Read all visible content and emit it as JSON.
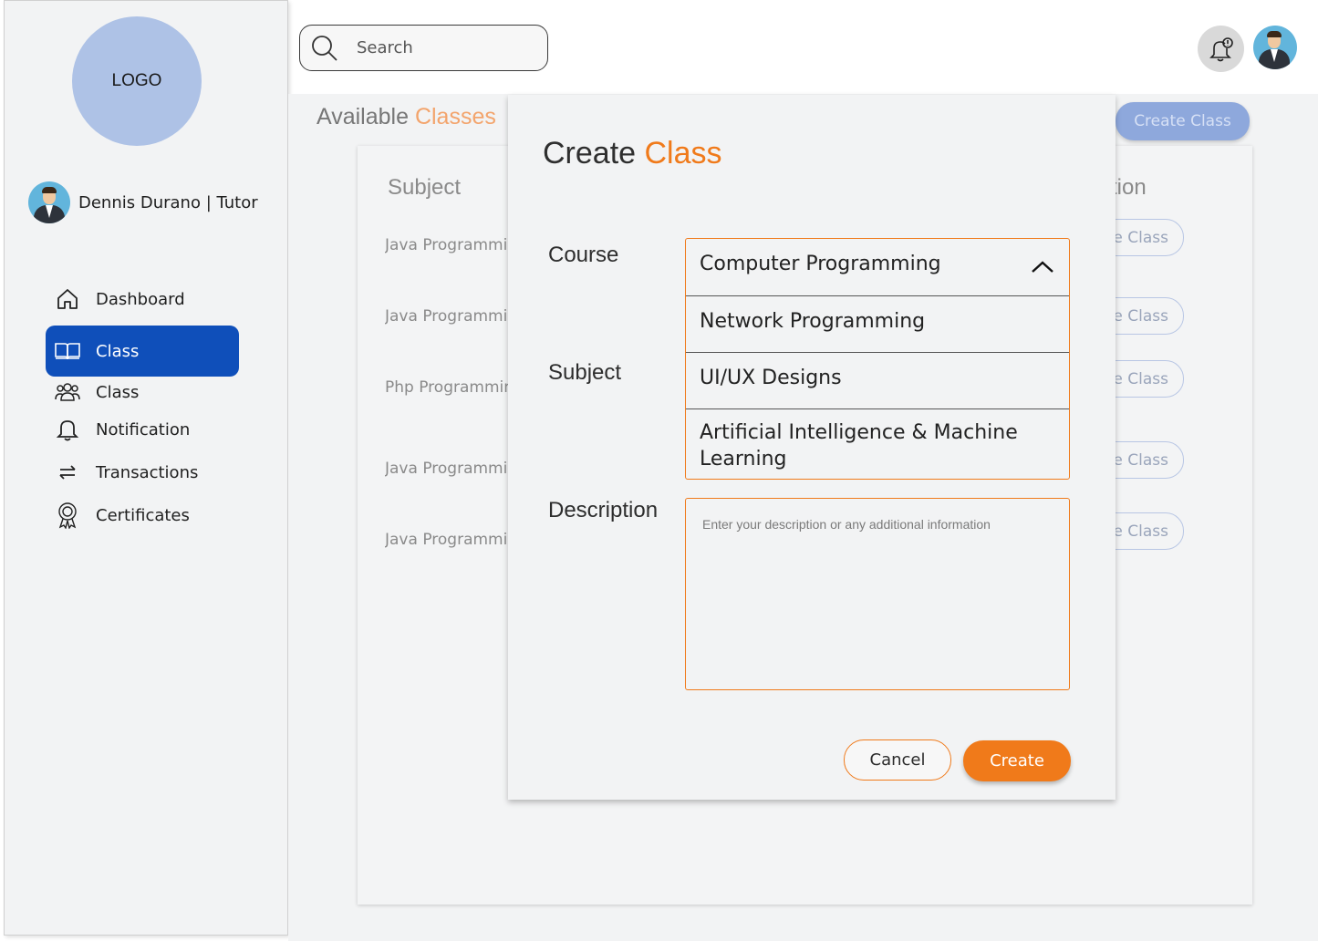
{
  "sidebar": {
    "logo_text": "LOGO",
    "user_name": "Dennis Durano | Tutor",
    "nav": [
      {
        "label": "Dashboard",
        "icon": "home-icon"
      },
      {
        "label": "Class",
        "icon": "book-icon",
        "active": true
      },
      {
        "label": "Class",
        "icon": "users-icon"
      },
      {
        "label": "Notification",
        "icon": "bell-icon"
      },
      {
        "label": "Transactions",
        "icon": "swap-arrows-icon"
      },
      {
        "label": "Certificates",
        "icon": "certificate-icon"
      }
    ]
  },
  "topbar": {
    "search_placeholder": "Search"
  },
  "page": {
    "title_plain": "Available ",
    "title_accent": "Classes",
    "create_button": "Create Class",
    "columns": {
      "subject": "Subject",
      "action": "tion"
    },
    "rows": [
      {
        "subject": "Java Programming",
        "action": "e Class"
      },
      {
        "subject": "Java Programming",
        "action": "e Class"
      },
      {
        "subject": "Php Programming",
        "action": "e Class"
      },
      {
        "subject": "Java Programming",
        "action": "e Class"
      },
      {
        "subject": "Java Programming",
        "action": "e Class"
      }
    ]
  },
  "modal": {
    "title_plain": "Create ",
    "title_accent": "Class",
    "course_label": "Course",
    "subject_label": "Subject",
    "description_label": "Description",
    "selected_course": "Computer Programming",
    "options": [
      "Network Programming",
      "UI/UX Designs",
      "Artificial Intelligence & Machine Learning"
    ],
    "description_placeholder": "Enter your description or any additional information",
    "cancel": "Cancel",
    "create": "Create"
  },
  "colors": {
    "accent": "#f07a1a",
    "primary": "#0f4fba"
  }
}
